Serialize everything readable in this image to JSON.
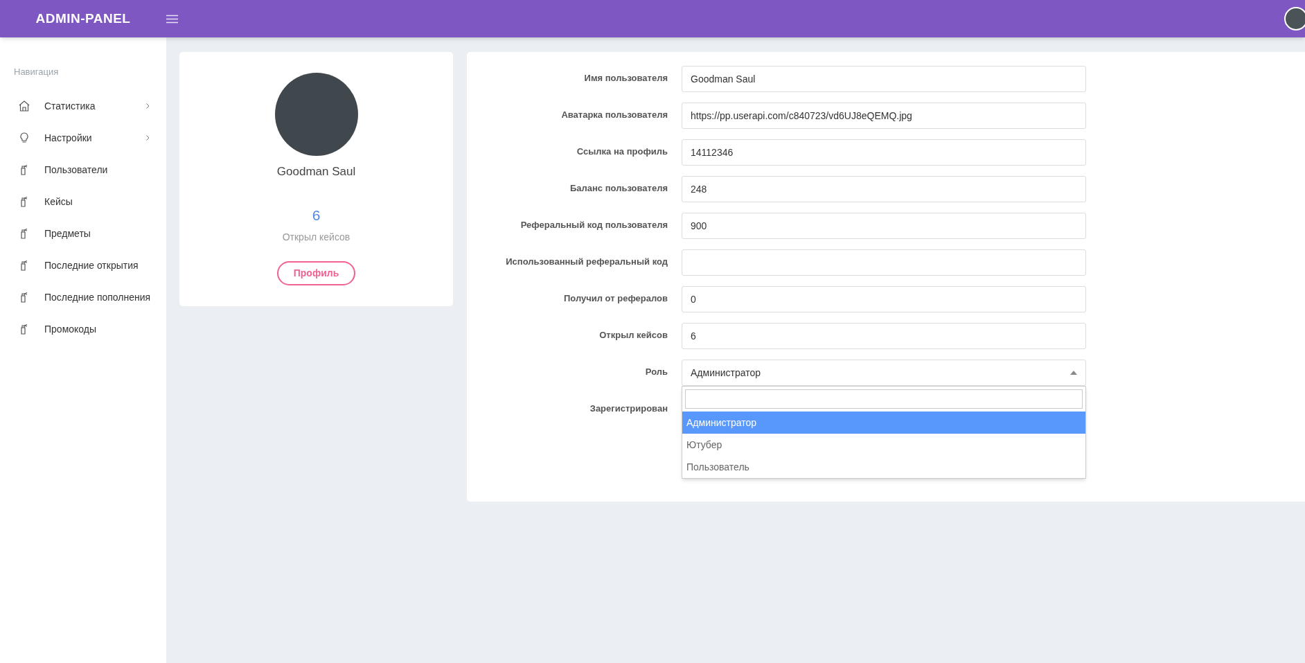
{
  "header": {
    "logo": "ADMIN-PANEL"
  },
  "sidebar": {
    "heading": "Навигация",
    "items": [
      {
        "label": "Статистика",
        "kind": "home",
        "has_submenu": true
      },
      {
        "label": "Настройки",
        "kind": "bulb",
        "has_submenu": true
      },
      {
        "label": "Пользователи",
        "kind": "spray",
        "has_submenu": false
      },
      {
        "label": "Кейсы",
        "kind": "spray",
        "has_submenu": false
      },
      {
        "label": "Предметы",
        "kind": "spray",
        "has_submenu": false
      },
      {
        "label": "Последние открытия",
        "kind": "spray",
        "has_submenu": false
      },
      {
        "label": "Последние пополнения",
        "kind": "spray",
        "has_submenu": false
      },
      {
        "label": "Промокоды",
        "kind": "spray",
        "has_submenu": false
      }
    ]
  },
  "profile_card": {
    "name": "Goodman Saul",
    "stat_value": "6",
    "stat_label": "Открыл кейсов",
    "button": "Профиль"
  },
  "form": {
    "fields": [
      {
        "kind": "input",
        "label": "Имя пользователя",
        "value": "Goodman Saul"
      },
      {
        "kind": "input",
        "label": "Аватарка пользователя",
        "value": "https://pp.userapi.com/c840723/vd6UJ8eQEMQ.jpg"
      },
      {
        "kind": "input",
        "label": "Ссылка на профиль",
        "value": "14112346"
      },
      {
        "kind": "input",
        "label": "Баланс пользователя",
        "value": "248"
      },
      {
        "kind": "input",
        "label": "Реферальный код пользователя",
        "value": "900"
      },
      {
        "kind": "input",
        "label": "Использованный реферальный код"
      },
      {
        "kind": "input",
        "label": "Получил от рефералов",
        "value": "0"
      },
      {
        "kind": "input",
        "label": "Открыл кейсов",
        "value": "6"
      },
      {
        "kind": "select",
        "label": "Роль",
        "value": "Администратор",
        "expanded": true,
        "options": [
          {
            "label": "Администратор",
            "selected": true
          },
          {
            "label": "Ютубер",
            "selected": false
          },
          {
            "label": "Пользователь",
            "selected": false
          }
        ]
      },
      {
        "kind": "hidden",
        "label": "Зарегистрирован"
      }
    ]
  }
}
